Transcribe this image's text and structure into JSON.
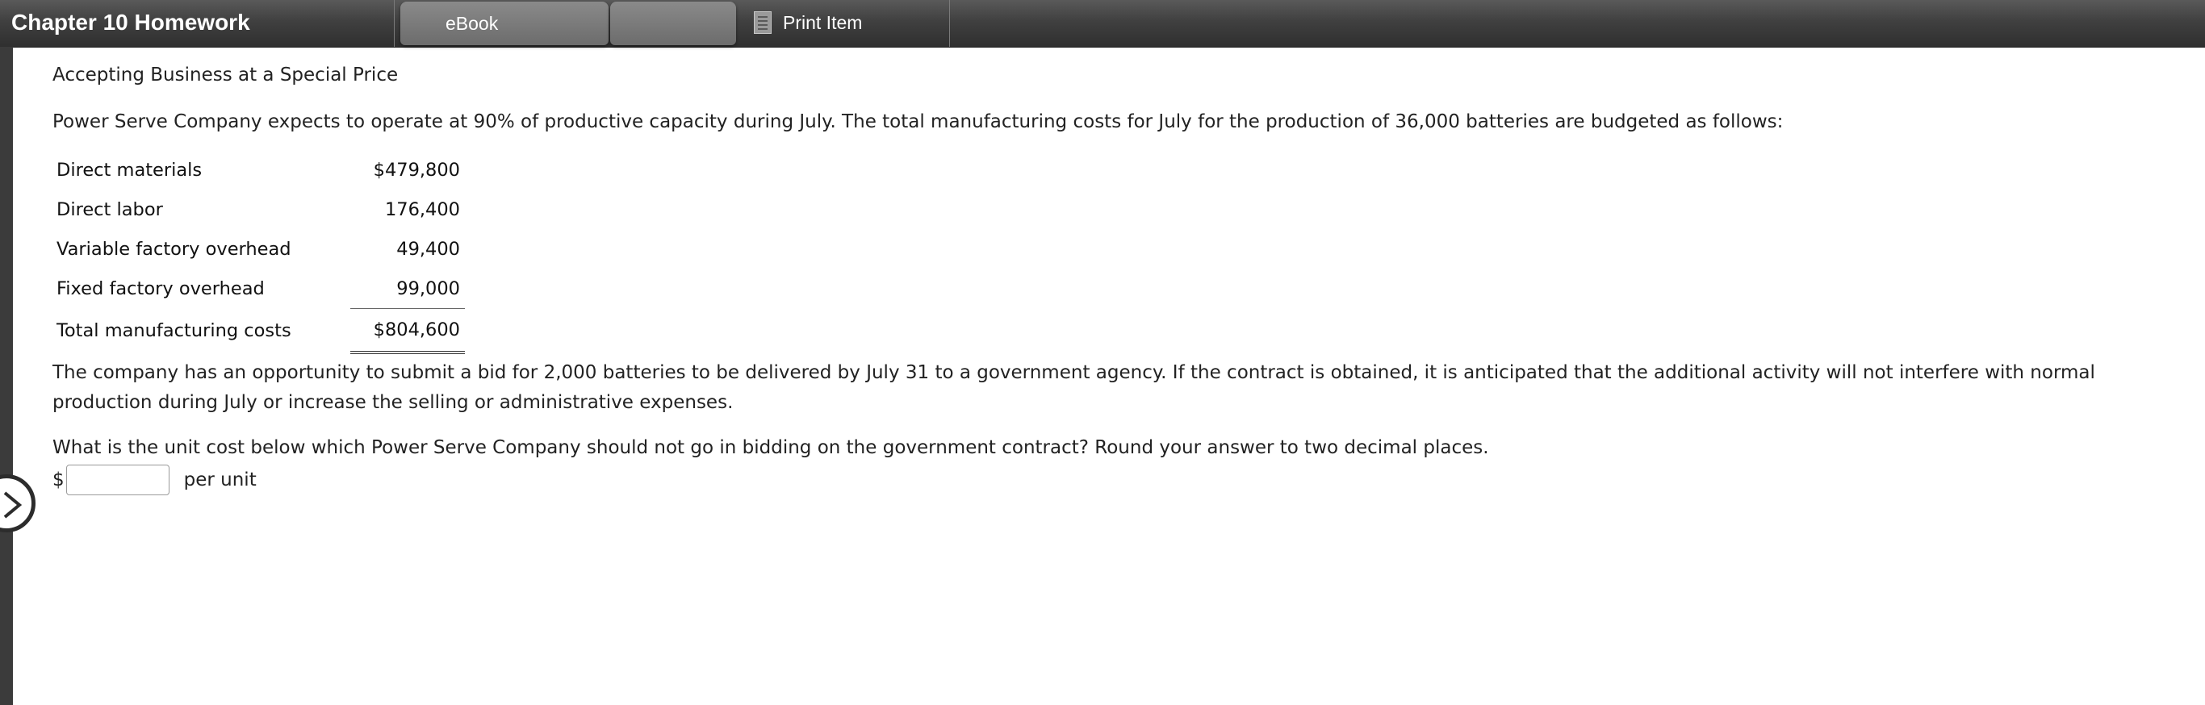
{
  "header": {
    "title": "Chapter 10 Homework",
    "tabs": [
      {
        "label": "eBook"
      },
      {
        "label": ""
      }
    ],
    "print_label": "Print Item"
  },
  "problem": {
    "heading": "Accepting Business at a Special Price",
    "intro": "Power Serve Company expects to operate at 90% of productive capacity during July. The total manufacturing costs for July for the production of 36,000 batteries are budgeted as follows:",
    "costs": [
      {
        "label": "Direct materials",
        "amount": "$479,800"
      },
      {
        "label": "Direct labor",
        "amount": "176,400"
      },
      {
        "label": "Variable factory overhead",
        "amount": "49,400"
      },
      {
        "label": "Fixed factory overhead",
        "amount": "99,000"
      }
    ],
    "total": {
      "label": "Total manufacturing costs",
      "amount": "$804,600"
    },
    "paragraph": "The company has an opportunity to submit a bid for 2,000 batteries to be delivered by July 31 to a government agency. If the contract is obtained, it is anticipated that the additional activity will not interfere with normal production during July or increase the selling or administrative expenses.",
    "question": "What is the unit cost below which Power Serve Company should not go in bidding on the government contract? Round your answer to two decimal places.",
    "answer": {
      "prefix": "$",
      "value": "",
      "suffix": "per unit"
    }
  },
  "icons": {
    "print": "print-document-icon",
    "side_toggle": "chevron-right-icon"
  },
  "colors": {
    "header_bg": "#3a3a3a",
    "tab_bg": "#7a7a7a",
    "sidebar": "#3b3b3b"
  }
}
